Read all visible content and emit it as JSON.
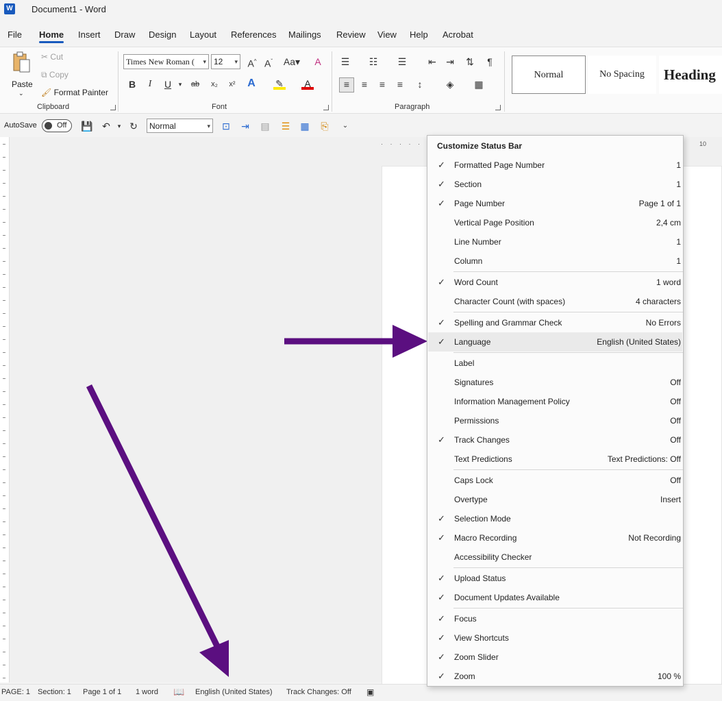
{
  "title": "Document1  -  Word",
  "tabs": [
    "File",
    "Home",
    "Insert",
    "Draw",
    "Design",
    "Layout",
    "References",
    "Mailings",
    "Review",
    "View",
    "Help",
    "Acrobat"
  ],
  "clipboard": {
    "paste": "Paste",
    "cut": "Cut",
    "copy": "Copy",
    "format_painter": "Format Painter",
    "label": "Clipboard"
  },
  "font": {
    "name": "Times New Roman (",
    "size": "12",
    "label": "Font",
    "bold": "B",
    "italic": "I",
    "underline": "U"
  },
  "paragraph": {
    "label": "Paragraph"
  },
  "styles": [
    "Normal",
    "No Spacing",
    "Heading"
  ],
  "qat": {
    "autosave": "AutoSave",
    "toggle": "Off",
    "style": "Normal"
  },
  "ruler": {
    "mark": "10"
  },
  "menu": {
    "title": "Customize Status Bar",
    "items": [
      {
        "label": "Formatted Page Number",
        "value": "1",
        "checked": true
      },
      {
        "label": "Section",
        "value": "1",
        "checked": true
      },
      {
        "label": "Page Number",
        "value": "Page 1 of 1",
        "checked": true
      },
      {
        "label": "Vertical Page Position",
        "value": "2,4 cm",
        "checked": false
      },
      {
        "label": "Line Number",
        "value": "1",
        "checked": false
      },
      {
        "label": "Column",
        "value": "1",
        "checked": false
      },
      {
        "label": "Word Count",
        "value": "1 word",
        "checked": true
      },
      {
        "label": "Character Count (with spaces)",
        "value": "4 characters",
        "checked": false
      },
      {
        "label": "Spelling and Grammar Check",
        "value": "No Errors",
        "checked": true
      },
      {
        "label": "Language",
        "value": "English (United States)",
        "checked": true
      },
      {
        "label": "Label",
        "value": "",
        "checked": false
      },
      {
        "label": "Signatures",
        "value": "Off",
        "checked": false
      },
      {
        "label": "Information Management Policy",
        "value": "Off",
        "checked": false
      },
      {
        "label": "Permissions",
        "value": "Off",
        "checked": false
      },
      {
        "label": "Track Changes",
        "value": "Off",
        "checked": true
      },
      {
        "label": "Text Predictions",
        "value": "Text Predictions: Off",
        "checked": false
      },
      {
        "label": "Caps Lock",
        "value": "Off",
        "checked": false
      },
      {
        "label": "Overtype",
        "value": "Insert",
        "checked": false
      },
      {
        "label": "Selection Mode",
        "value": "",
        "checked": true
      },
      {
        "label": "Macro Recording",
        "value": "Not Recording",
        "checked": true
      },
      {
        "label": "Accessibility Checker",
        "value": "",
        "checked": false
      },
      {
        "label": "Upload Status",
        "value": "",
        "checked": true
      },
      {
        "label": "Document Updates Available",
        "value": "",
        "checked": true
      },
      {
        "label": "Focus",
        "value": "",
        "checked": true
      },
      {
        "label": "View Shortcuts",
        "value": "",
        "checked": true
      },
      {
        "label": "Zoom Slider",
        "value": "",
        "checked": true
      },
      {
        "label": "Zoom",
        "value": "100 %",
        "checked": true
      }
    ]
  },
  "status": {
    "page": "PAGE: 1",
    "section": "Section: 1",
    "pageof": "Page 1 of 1",
    "words": "1 word",
    "language": "English (United States)",
    "track": "Track Changes: Off"
  },
  "colors": {
    "arrow": "#5b0f80",
    "accent": "#185abd"
  }
}
